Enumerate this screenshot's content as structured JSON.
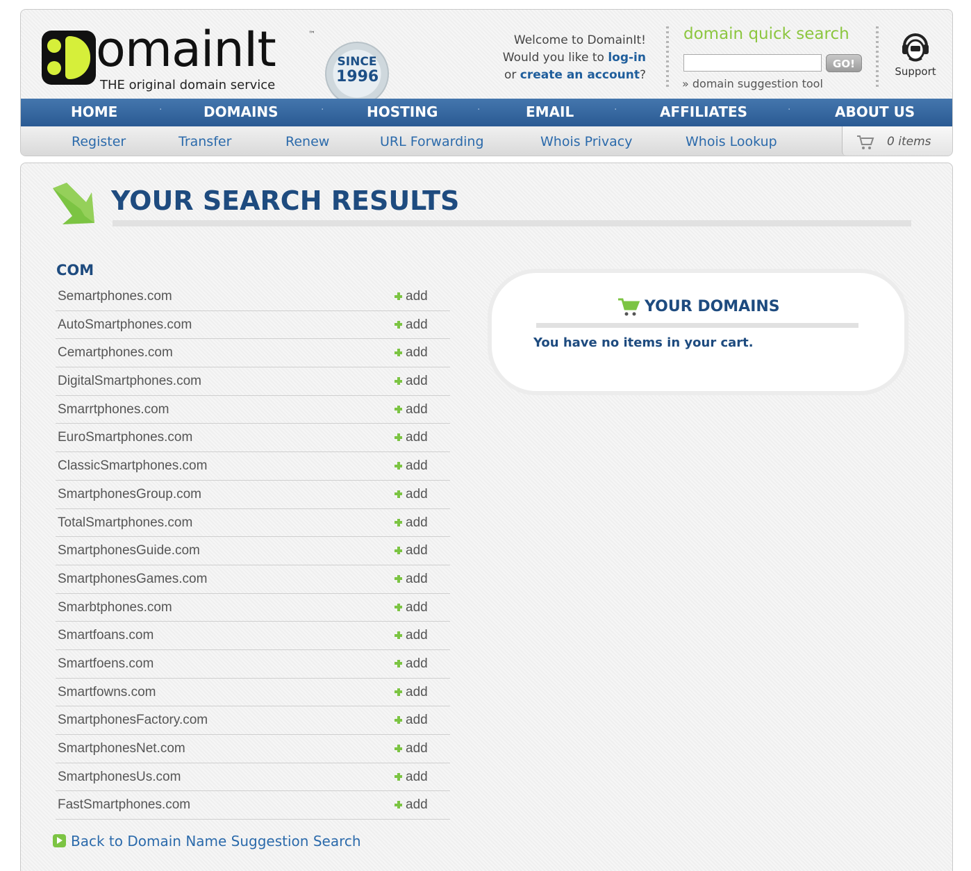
{
  "brand": {
    "logo_text": "omainIt",
    "tagline": "THE original domain service",
    "seal_line1": "SINCE",
    "seal_line2": "1996"
  },
  "welcome": {
    "line1": "Welcome to DomainIt!",
    "line2_prefix": "Would you like to ",
    "login_label": "log-in",
    "line3_prefix": "or ",
    "create_account_label": "create an account",
    "line3_suffix": "?"
  },
  "quick_search": {
    "title": "domain quick search",
    "input_value": "",
    "go_label": "GO!",
    "suggestion_link": "» domain suggestion tool"
  },
  "support": {
    "label": "Support"
  },
  "main_nav": [
    "HOME",
    "DOMAINS",
    "HOSTING",
    "EMAIL",
    "AFFILIATES",
    "ABOUT US"
  ],
  "sub_nav": [
    "Register",
    "Transfer",
    "Renew",
    "URL Forwarding",
    "Whois Privacy",
    "Whois Lookup"
  ],
  "cart": {
    "count_label": "0 items"
  },
  "page": {
    "title": "YOUR SEARCH RESULTS",
    "tld_heading": "COM",
    "add_label": "add",
    "results": [
      "Semartphones.com",
      "AutoSmartphones.com",
      "Cemartphones.com",
      "DigitalSmartphones.com",
      "Smarrtphones.com",
      "EuroSmartphones.com",
      "ClassicSmartphones.com",
      "SmartphonesGroup.com",
      "TotalSmartphones.com",
      "SmartphonesGuide.com",
      "SmartphonesGames.com",
      "Smarbtphones.com",
      "Smartfoans.com",
      "Smartfoens.com",
      "Smartfowns.com",
      "SmartphonesFactory.com",
      "SmartphonesNet.com",
      "SmartphonesUs.com",
      "FastSmartphones.com"
    ],
    "back_link": "Back to Domain Name Suggestion Search"
  },
  "your_domains": {
    "title": "YOUR DOMAINS",
    "empty_message": "You have no items in your cart."
  },
  "colors": {
    "nav_blue": "#2a5a93",
    "link_blue": "#2b6aab",
    "heading_navy": "#1e4b7f",
    "accent_green": "#8cc63f"
  }
}
